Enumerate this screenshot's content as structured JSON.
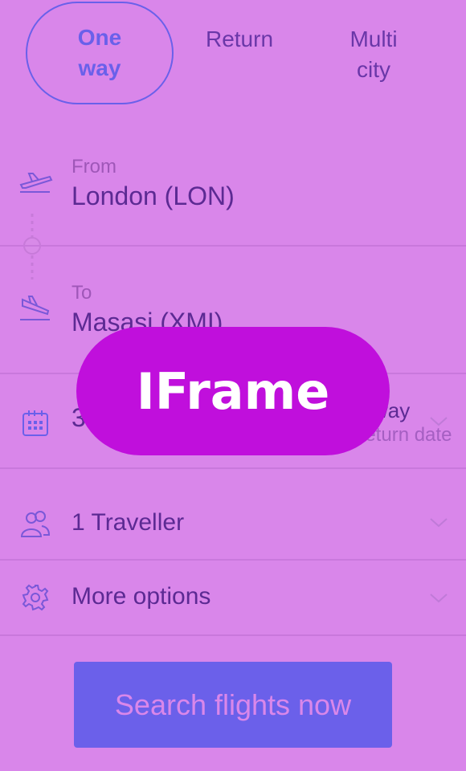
{
  "trip_tabs": [
    {
      "label_line1": "One",
      "label_line2": "way"
    },
    {
      "label_line1": "Return"
    },
    {
      "label_line1": "Multi",
      "label_line2": "city"
    }
  ],
  "from": {
    "label": "From",
    "value": "London (LON)"
  },
  "to": {
    "label": "To",
    "value": "Masasi (XMI)"
  },
  "dates": {
    "value_visible": "3",
    "trip_type_fragment": "way",
    "return_hint": "Return date"
  },
  "travellers": {
    "value": "1 Traveller"
  },
  "more_options": {
    "value": "More options"
  },
  "search": {
    "label": "Search flights now"
  },
  "overlay": {
    "label": "IFrame"
  },
  "colors": {
    "background": "#d986ea",
    "accent": "#6b60ea",
    "text_dark": "#5c2a93",
    "overlay": "#c00fdc"
  }
}
